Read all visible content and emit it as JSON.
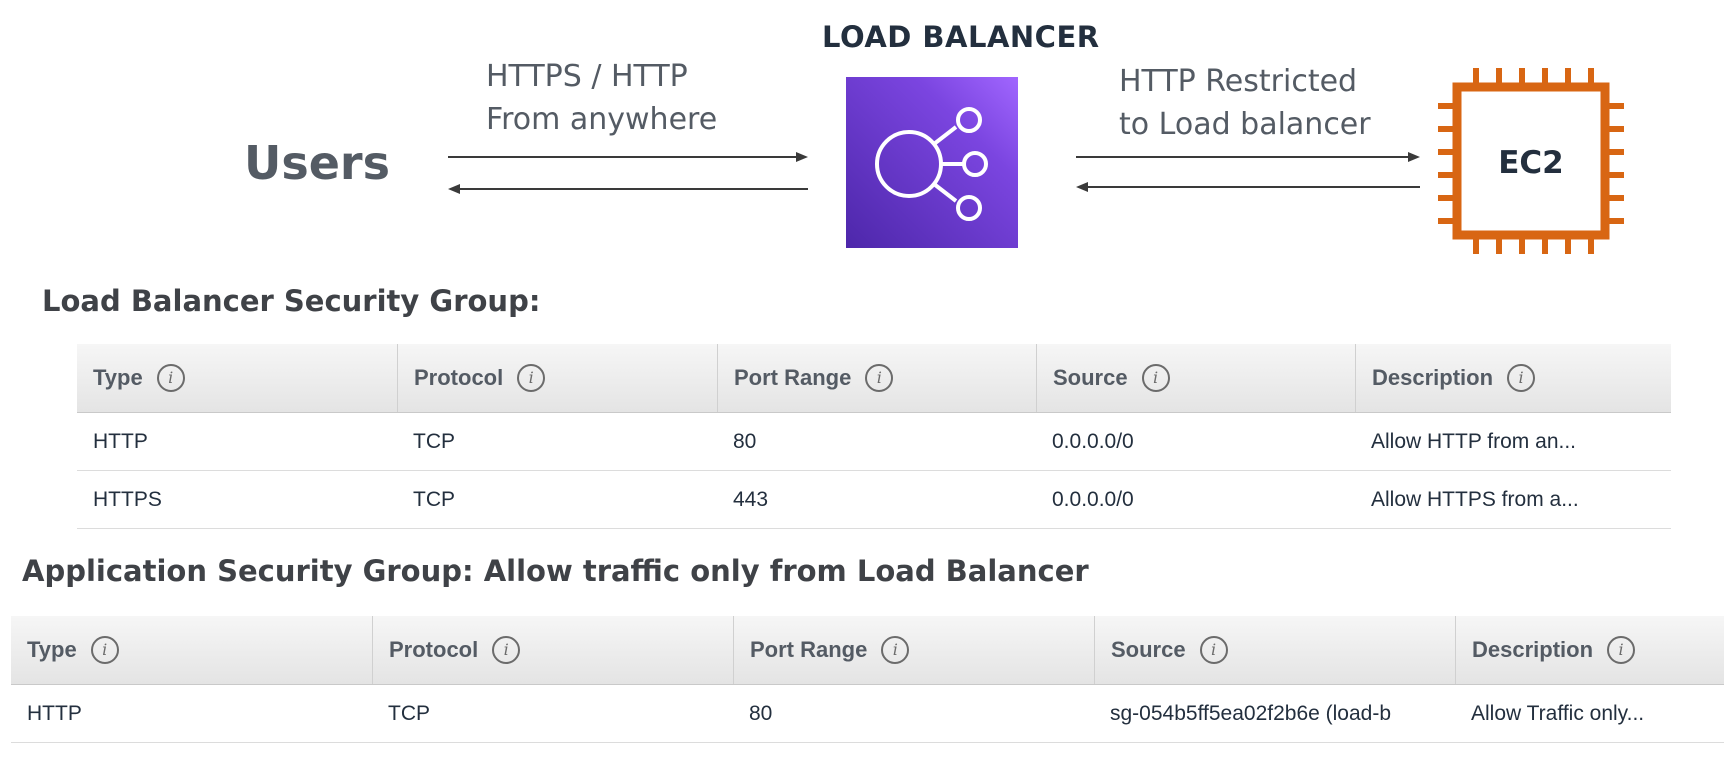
{
  "diagram": {
    "users_label": "Users",
    "lb_title": "LOAD BALANCER",
    "left_arrow_label_line1": "HTTPS / HTTP",
    "left_arrow_label_line2": "From anywhere",
    "right_arrow_label_line1": "HTTP Restricted",
    "right_arrow_label_line2": "to Load balancer",
    "ec2_label": "EC2",
    "lb_icon": "load-balancer-icon",
    "ec2_icon": "ec2-chip-icon",
    "colors": {
      "lb_gradient_start": "#4d27aa",
      "lb_gradient_end": "#a166ff",
      "ec2_orange": "#d86613",
      "text_gray": "#545b64"
    }
  },
  "lb_sg": {
    "title": "Load Balancer Security Group:",
    "headers": [
      "Type",
      "Protocol",
      "Port Range",
      "Source",
      "Description"
    ],
    "rows": [
      [
        "HTTP",
        "TCP",
        "80",
        "0.0.0.0/0",
        "Allow HTTP from an..."
      ],
      [
        "HTTPS",
        "TCP",
        "443",
        "0.0.0.0/0",
        "Allow HTTPS from a..."
      ]
    ]
  },
  "app_sg": {
    "title": "Application Security Group: Allow traffic only from Load Balancer",
    "headers": [
      "Type",
      "Protocol",
      "Port Range",
      "Source",
      "Description"
    ],
    "rows": [
      [
        "HTTP",
        "TCP",
        "80",
        "sg-054b5ff5ea02f2b6e (load-b",
        "Allow Traffic only..."
      ]
    ]
  },
  "info_icon_glyph": "i"
}
